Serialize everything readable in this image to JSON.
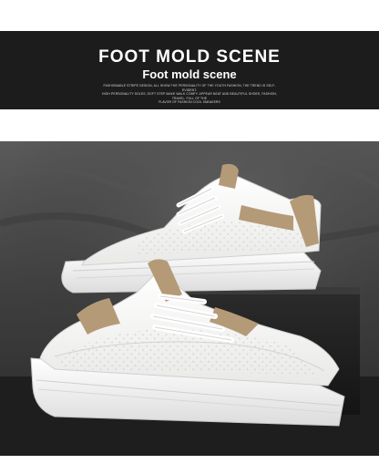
{
  "header": {
    "title": "FOOT MOLD SCENE",
    "subtitle": "Foot mold scene",
    "blurb_lines": [
      "FASHIONABLE STRIPE DESIGN, ALL SHOW THE PERSONALITY OF THE YOUTH FASHION, THE TREND IS SELF-EVIDENT.",
      "HIGH PERSONALITY SOLES, SOFT STEP MAKE WALK COMFY. APPEAR NEAT AND BEAUTIFUL SHOES, FASHION, TRAVEL, FULL OF THE",
      "FLAVOR OF FASHION COOL SNEAKERS"
    ]
  },
  "colors": {
    "header_band": "#1c1c1c",
    "shoe_upper": "#f4f4f2",
    "accent_tan": "#b59a78",
    "background_gray": "#4a4a4a"
  }
}
